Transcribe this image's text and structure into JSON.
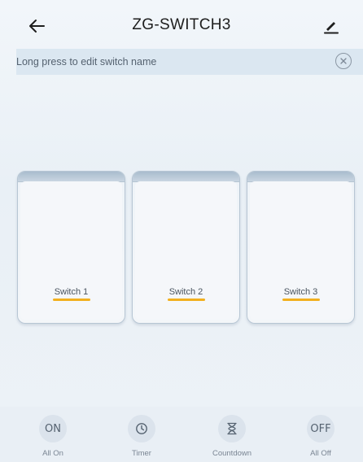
{
  "header": {
    "title": "ZG-SWITCH3"
  },
  "notice": {
    "text": "Long press to edit switch name"
  },
  "switches": [
    {
      "label": "Switch 1"
    },
    {
      "label": "Switch 2"
    },
    {
      "label": "Switch 3"
    }
  ],
  "actions": [
    {
      "icon_text": "ON",
      "label": "All On"
    },
    {
      "icon_text": "",
      "label": "Timer"
    },
    {
      "icon_text": "",
      "label": "Countdown"
    },
    {
      "icon_text": "OFF",
      "label": "All Off"
    }
  ],
  "colors": {
    "accent": "#f2b01e",
    "notice_bg": "#dbe7f1",
    "action_bg": "#dbe3ec"
  },
  "icons": {
    "back": "arrow-left-icon",
    "edit": "pencil-icon",
    "close": "close-circle-icon",
    "timer": "clock-icon",
    "countdown": "hourglass-icon"
  }
}
